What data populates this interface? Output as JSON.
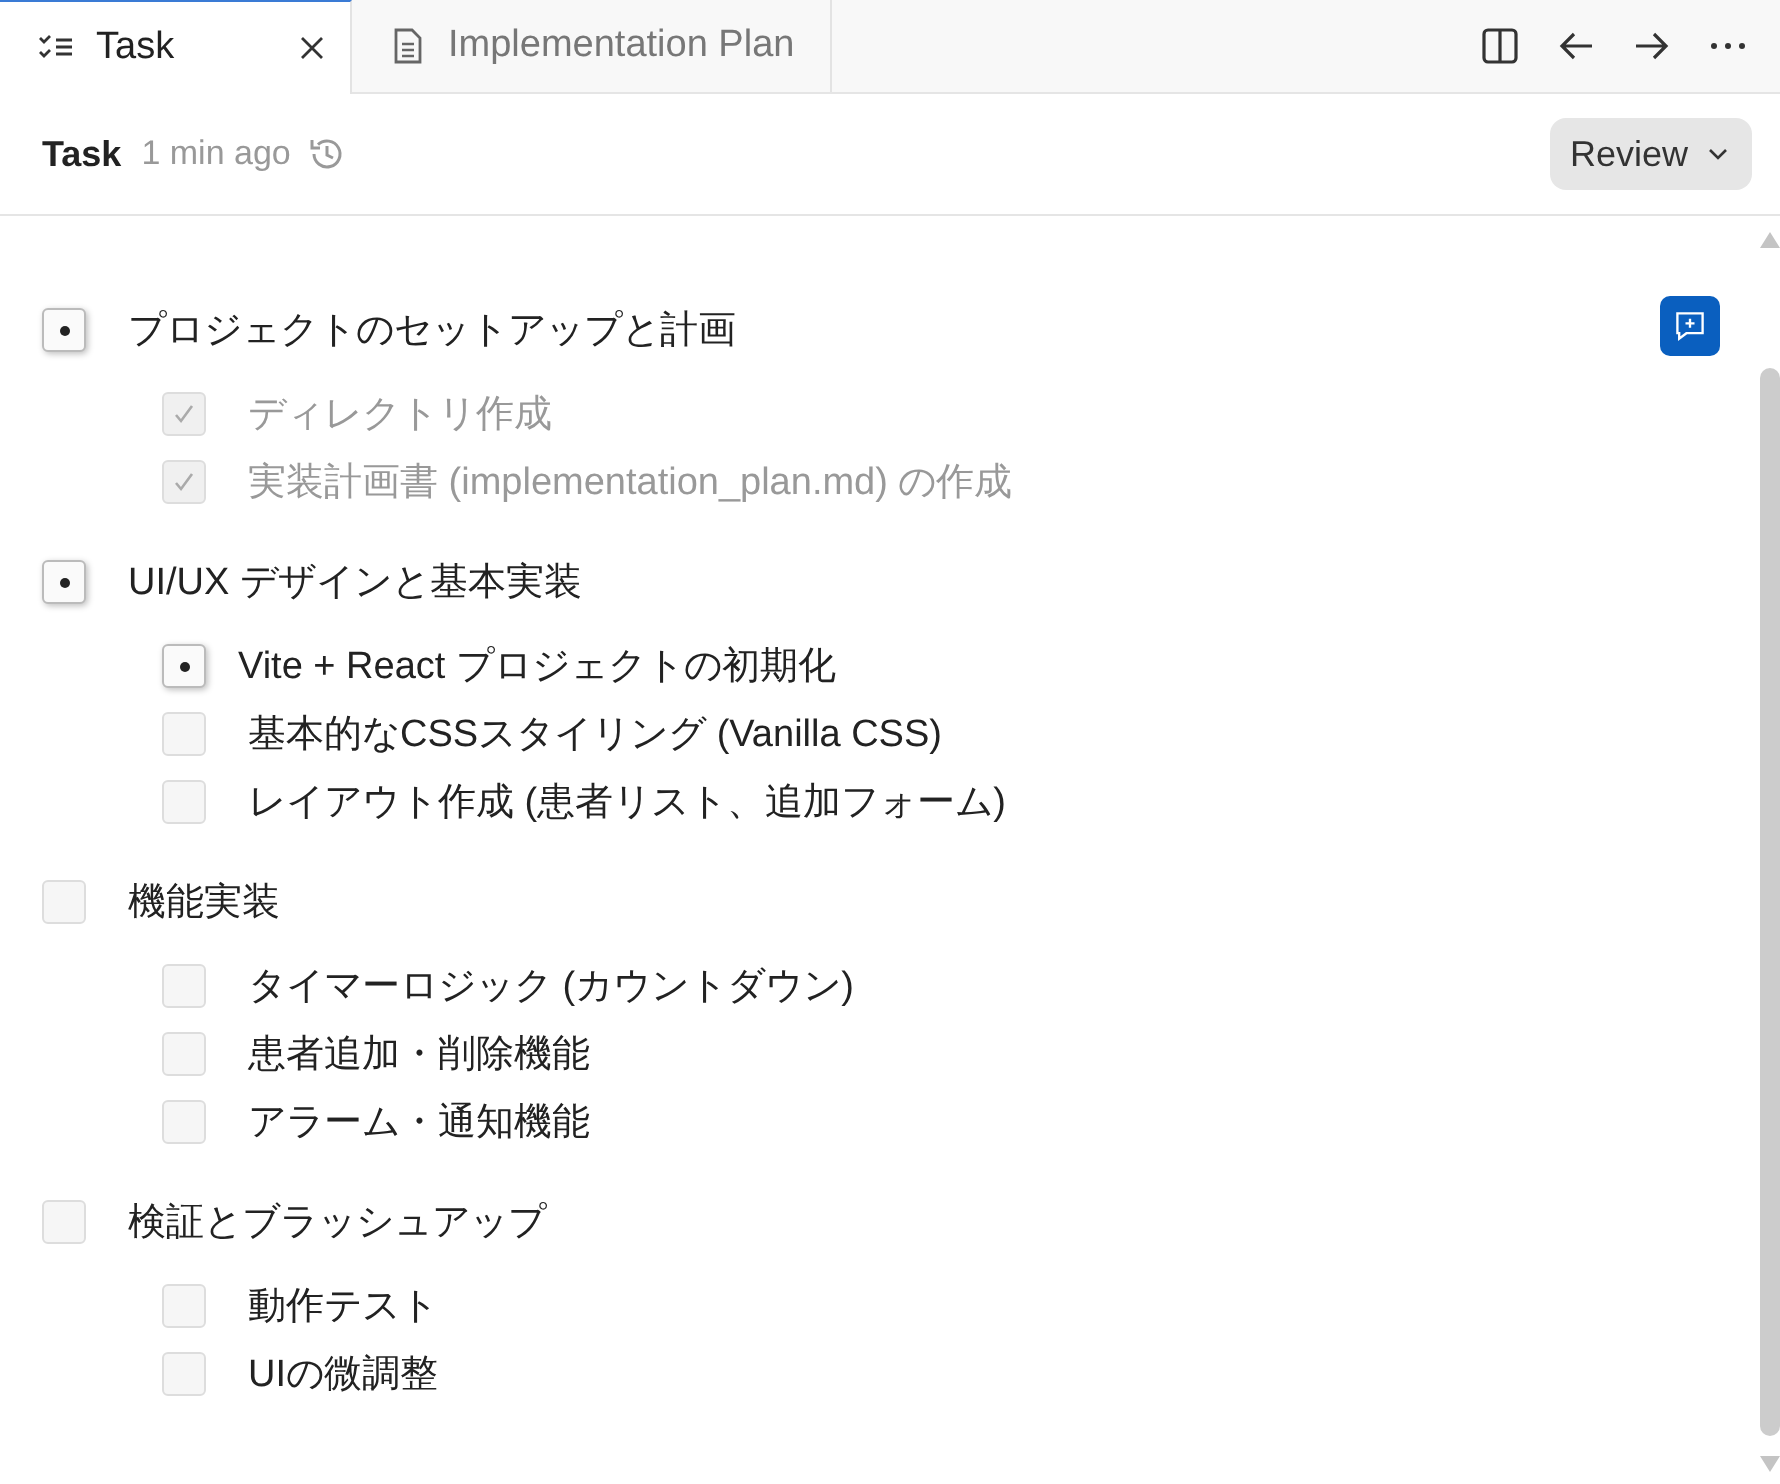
{
  "tabs": [
    {
      "label": "Task",
      "selected": true,
      "closable": true
    },
    {
      "label": "Implementation Plan",
      "selected": false,
      "closable": false
    }
  ],
  "header": {
    "title": "Task",
    "time": "1 min ago",
    "review_button": "Review"
  },
  "tasks": [
    {
      "label": "プロジェクトのセットアップと計画",
      "checked": false,
      "in_progress": true,
      "children": [
        {
          "label": "ディレクトリ作成",
          "checked": true,
          "in_progress": false
        },
        {
          "label": "実装計画書 (implementation_plan.md) の作成",
          "checked": true,
          "in_progress": false
        }
      ]
    },
    {
      "label": "UI/UX デザインと基本実装",
      "checked": false,
      "in_progress": true,
      "children": [
        {
          "label": "Vite + React プロジェクトの初期化",
          "checked": false,
          "in_progress": true
        },
        {
          "label": "基本的なCSSスタイリング (Vanilla CSS)",
          "checked": false,
          "in_progress": false
        },
        {
          "label": "レイアウト作成 (患者リスト、追加フォーム)",
          "checked": false,
          "in_progress": false
        }
      ]
    },
    {
      "label": "機能実装",
      "checked": false,
      "in_progress": false,
      "children": [
        {
          "label": "タイマーロジック (カウントダウン)",
          "checked": false,
          "in_progress": false
        },
        {
          "label": "患者追加・削除機能",
          "checked": false,
          "in_progress": false
        },
        {
          "label": "アラーム・通知機能",
          "checked": false,
          "in_progress": false
        }
      ]
    },
    {
      "label": "検証とブラッシュアップ",
      "checked": false,
      "in_progress": false,
      "children": [
        {
          "label": "動作テスト",
          "checked": false,
          "in_progress": false
        },
        {
          "label": "UIの微調整",
          "checked": false,
          "in_progress": false
        }
      ]
    }
  ]
}
